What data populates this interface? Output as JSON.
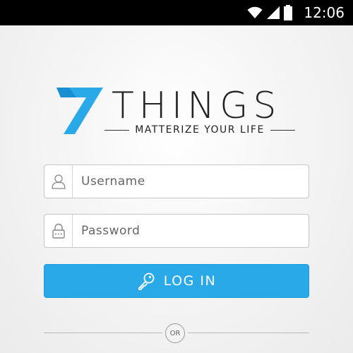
{
  "status_bar": {
    "time": "12:06",
    "icons": [
      "wifi-icon",
      "signal-icon",
      "battery-icon"
    ]
  },
  "brand": {
    "logo_number": "7",
    "name": "THINGS",
    "tagline": "MATTERIZE YOUR LIFE",
    "accent_color": "#2aa9e8"
  },
  "form": {
    "username_placeholder": "Username",
    "password_placeholder": "Password",
    "login_label": "LOG IN",
    "divider_label": "OR"
  }
}
